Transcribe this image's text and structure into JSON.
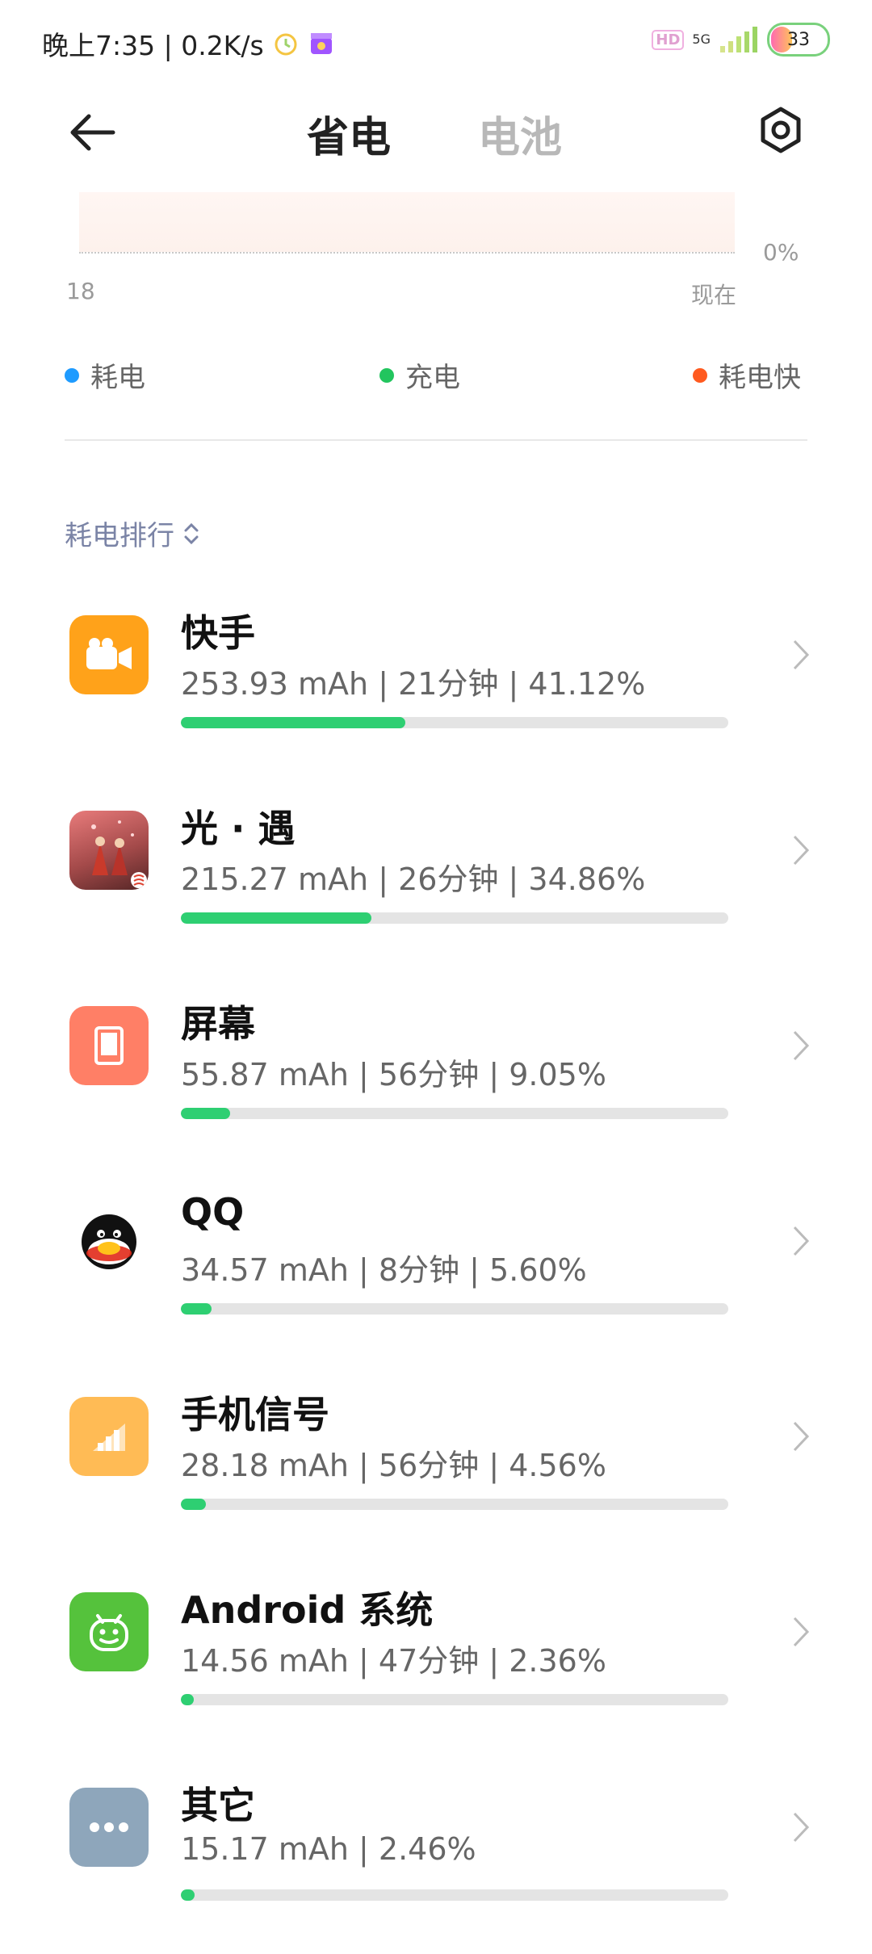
{
  "status": {
    "time_speed": "晚上7:35 | 0.2K/s",
    "network": "5G",
    "hd": "HD",
    "battery": "33"
  },
  "header": {
    "tab_power_saving": "省电",
    "tab_battery": "电池"
  },
  "chart": {
    "percent_label": "0%",
    "start_label": "18",
    "end_label": "现在"
  },
  "legend": [
    {
      "label": "耗电",
      "color": "#1e9bff"
    },
    {
      "label": "充电",
      "color": "#22c55e"
    },
    {
      "label": "耗电快",
      "color": "#ff5a1f"
    }
  ],
  "ranking": {
    "title": "耗电排行"
  },
  "apps": [
    {
      "name": "快手",
      "stats": "253.93 mAh | 21分钟 | 41.12%",
      "percent": 41.12,
      "icon": "kuaishou-icon"
    },
    {
      "name": "光 · 遇",
      "stats": "215.27 mAh | 26分钟 | 34.86%",
      "percent": 34.86,
      "icon": "sky-icon"
    },
    {
      "name": "屏幕",
      "stats": "55.87 mAh | 56分钟 | 9.05%",
      "percent": 9.05,
      "icon": "screen-icon"
    },
    {
      "name": "QQ",
      "stats": "34.57 mAh | 8分钟 | 5.60%",
      "percent": 5.6,
      "icon": "qq-icon"
    },
    {
      "name": "手机信号",
      "stats": "28.18 mAh | 56分钟 | 4.56%",
      "percent": 4.56,
      "icon": "signal-icon"
    },
    {
      "name": "Android 系统",
      "stats": "14.56 mAh | 47分钟 | 2.36%",
      "percent": 2.36,
      "icon": "android-icon"
    },
    {
      "name": "其它",
      "stats": "15.17 mAh | 2.46%",
      "percent": 2.46,
      "icon": "more-icon"
    }
  ],
  "colors": {
    "bar_fill": "#2ecf72",
    "bar_track": "#e4e4e4",
    "kuaishou": "#ffa21a",
    "screen": "#ff7f66",
    "signal": "#ffbb55",
    "android": "#55c23c",
    "other": "#8ea6bb"
  }
}
